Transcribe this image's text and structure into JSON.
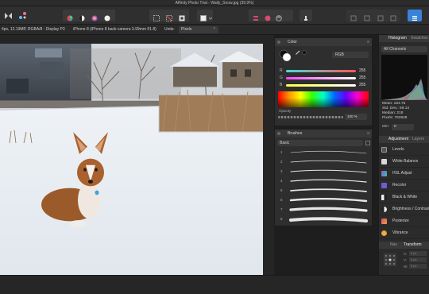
{
  "window": {
    "title": "Affinity Photo Trial - Wally_Snow.jpg (39.9%)"
  },
  "toolbar": {
    "personas": [
      "photo-persona-icon",
      "liquify-persona-icon"
    ],
    "view_tools": [
      "color-wheel-icon",
      "contrast-icon",
      "hue-icon",
      "lightness-icon"
    ],
    "selection_tools": [
      "marquee-icon",
      "deselect-icon",
      "invert-selection-icon"
    ],
    "quick_mask": "quick-mask-icon",
    "assistant": "assistant-icon",
    "arrange_tools": [
      "align-icon",
      "distribute-icon",
      "flip-icon",
      "rotate-icon"
    ],
    "studio": "studio-icon"
  },
  "contextbar": {
    "doc_info": "4px, 12.19MP, RGBA/8 - Display P3",
    "camera": "iPhone 8 (iPhone 8 back camera 3.99mm f/1.8)",
    "units_label": "Units:",
    "units_value": "Pixels"
  },
  "color_panel": {
    "title": "Color",
    "mode": "RGB",
    "channels": [
      {
        "label": "R",
        "value": "255",
        "color": "#ff5555"
      },
      {
        "label": "G",
        "value": "255",
        "color": "#44ddcc"
      },
      {
        "label": "B",
        "value": "255",
        "color": "#cc44ff"
      }
    ],
    "opacity_label": "Opacity",
    "opacity_value": "100 %"
  },
  "brushes_panel": {
    "title": "Brushes",
    "category": "Basic",
    "brushes": [
      {
        "num": "1"
      },
      {
        "num": "2"
      },
      {
        "num": "3"
      },
      {
        "num": "4"
      },
      {
        "num": "5"
      },
      {
        "num": "6"
      },
      {
        "num": "7"
      },
      {
        "num": "8"
      }
    ]
  },
  "right_col": {
    "histogram_tab": "Histogram",
    "swatches_tab": "Swatches",
    "channels_select": "All Channels",
    "stats": {
      "mean": "Mean: 164.75",
      "stddev": "Std. Dev.: 69.14",
      "median": "Median: 218",
      "pixels": "Pixels: 763948"
    },
    "min_label": "Min:",
    "min_value": "0",
    "adjust_tabs": [
      "Adjustment",
      "Layers",
      "Effects"
    ],
    "adjustments": [
      {
        "label": "Levels",
        "color": "#555555"
      },
      {
        "label": "White Balance",
        "color": "#d8d8d8"
      },
      {
        "label": "HSL Adjust",
        "color": "#c8485f"
      },
      {
        "label": "Recolor",
        "color": "#6c5dd6"
      },
      {
        "label": "Black & White",
        "color": "#e9e9e9"
      },
      {
        "label": "Brightness / Contrast",
        "color": "#f1f1f1"
      },
      {
        "label": "Posterize",
        "color": "#d84a6f"
      },
      {
        "label": "Vibrance",
        "color": "#e08a3c"
      }
    ],
    "nav_tab": "Nav",
    "transform_tab": "Transform",
    "transform_fields": [
      {
        "label": "X:",
        "value": "0 px"
      },
      {
        "label": "Y:",
        "value": "0 px"
      },
      {
        "label": "W:",
        "value": "0 px"
      },
      {
        "label": "H:",
        "value": "0 px"
      }
    ]
  }
}
